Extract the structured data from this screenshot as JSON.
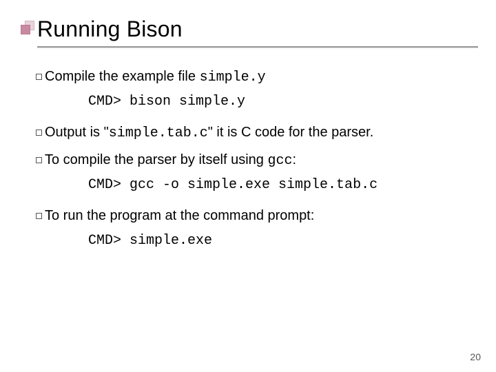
{
  "title": "Running Bison",
  "items": [
    {
      "pre": "Compile the example file ",
      "mono": "simple.y",
      "post": "",
      "code": "CMD> bison simple.y"
    },
    {
      "pre": "Output is \"",
      "mono": "simple.tab.c",
      "post": "\"  it is C code for the parser.",
      "code": null
    },
    {
      "pre": "To compile the parser by itself using ",
      "mono": "gcc",
      "post": ":",
      "code": "CMD> gcc -o simple.exe simple.tab.c"
    },
    {
      "pre": "To run the program at the command prompt:",
      "mono": "",
      "post": "",
      "code": "CMD> simple.exe"
    }
  ],
  "page_number": "20"
}
